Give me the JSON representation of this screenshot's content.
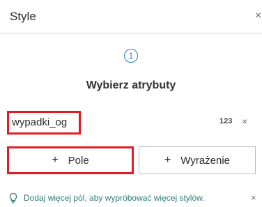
{
  "header": {
    "title": "Style",
    "close_icon": "close-icon"
  },
  "step": {
    "number": "1",
    "title": "Wybierz atrybuty"
  },
  "field": {
    "name": "wypadki_og",
    "type_label": "123",
    "remove_glyph": "×"
  },
  "buttons": {
    "pole": {
      "plus": "+",
      "label": "Pole"
    },
    "wyrazenie": {
      "plus": "+",
      "label": "Wyrażenie"
    }
  },
  "hint": {
    "icon": "lightbulb-icon",
    "text": "Dodaj więcej pól, aby wypróbować więcej stylów.",
    "dismiss_glyph": "×"
  },
  "colors": {
    "accent": "#2a7cc7",
    "highlight": "#e31b23",
    "hint": "#2e7a78"
  }
}
